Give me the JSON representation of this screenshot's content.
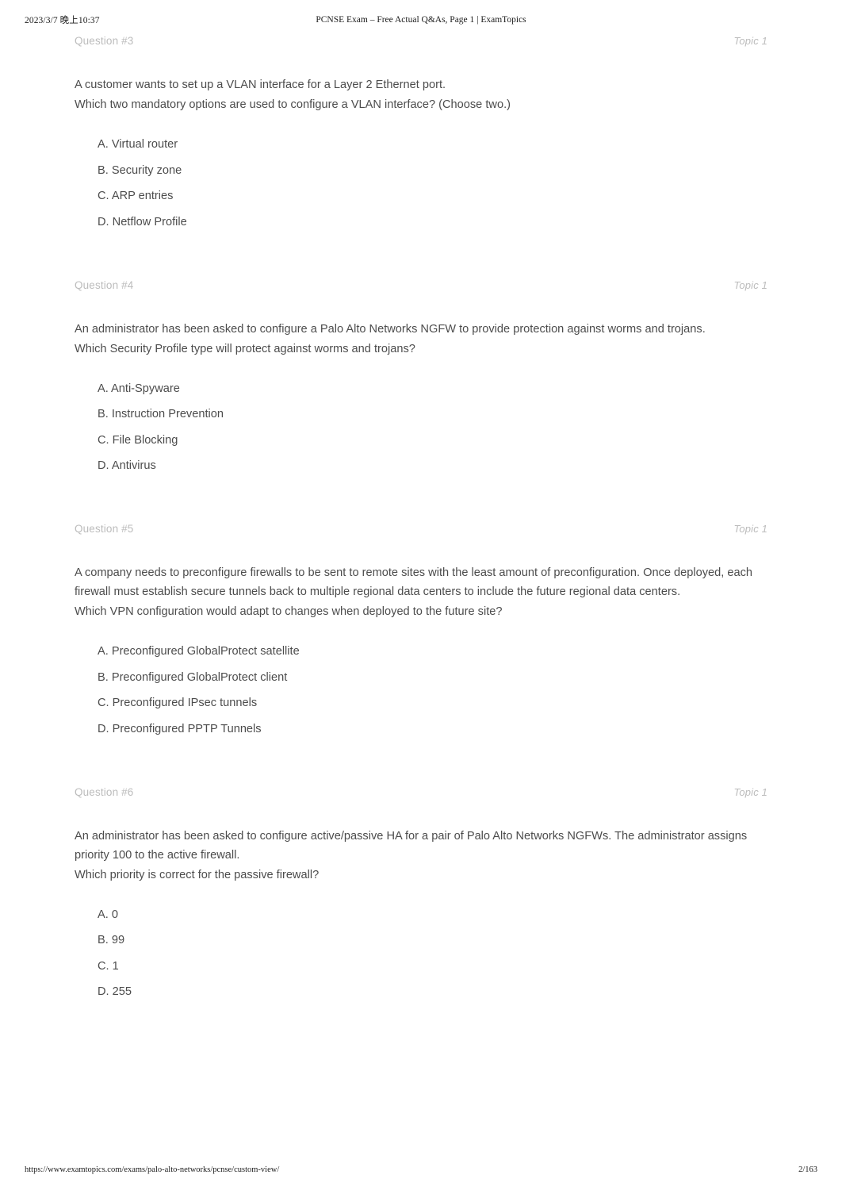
{
  "print_header": {
    "date": "2023/3/7 晚上10:37",
    "title": "PCNSE Exam – Free Actual Q&As, Page 1 | ExamTopics"
  },
  "print_footer": {
    "url": "https://www.examtopics.com/exams/palo-alto-networks/pcnse/custom-view/",
    "page": "2/163"
  },
  "colors": {
    "page_background": "#ffffff",
    "body_text": "#4c4c4c",
    "muted_text": "#bcbcbc",
    "header_text": "#1c1c1c"
  },
  "questions": [
    {
      "number": "Question #3",
      "topic": "Topic 1",
      "stem": [
        "A customer wants to set up a VLAN interface for a Layer 2 Ethernet port.",
        "Which two mandatory options are used to configure a VLAN interface? (Choose two.)"
      ],
      "choices": [
        "A. Virtual router",
        "B. Security zone",
        "C. ARP entries",
        "D. Netflow Profile"
      ]
    },
    {
      "number": "Question #4",
      "topic": "Topic 1",
      "stem": [
        "An administrator has been asked to configure a Palo Alto Networks NGFW to provide protection against worms and trojans.",
        "Which Security Profile type will protect against worms and trojans?"
      ],
      "choices": [
        "A. Anti-Spyware",
        "B. Instruction Prevention",
        "C. File Blocking",
        "D. Antivirus"
      ]
    },
    {
      "number": "Question #5",
      "topic": "Topic 1",
      "stem": [
        "A company needs to preconfigure firewalls to be sent to remote sites with the least amount of preconfiguration. Once deployed, each firewall must establish secure tunnels back to multiple regional data centers to include the future regional data centers.",
        "Which VPN configuration would adapt to changes when deployed to the future site?"
      ],
      "choices": [
        "A. Preconfigured GlobalProtect satellite",
        "B. Preconfigured GlobalProtect client",
        "C. Preconfigured IPsec tunnels",
        "D. Preconfigured PPTP Tunnels"
      ]
    },
    {
      "number": "Question #6",
      "topic": "Topic 1",
      "stem": [
        "An administrator has been asked to configure active/passive HA for a pair of Palo Alto Networks NGFWs. The administrator assigns priority 100 to the active firewall.",
        "Which priority is correct for the passive firewall?"
      ],
      "choices": [
        "A. 0",
        "B. 99",
        "C. 1",
        "D. 255"
      ]
    }
  ]
}
